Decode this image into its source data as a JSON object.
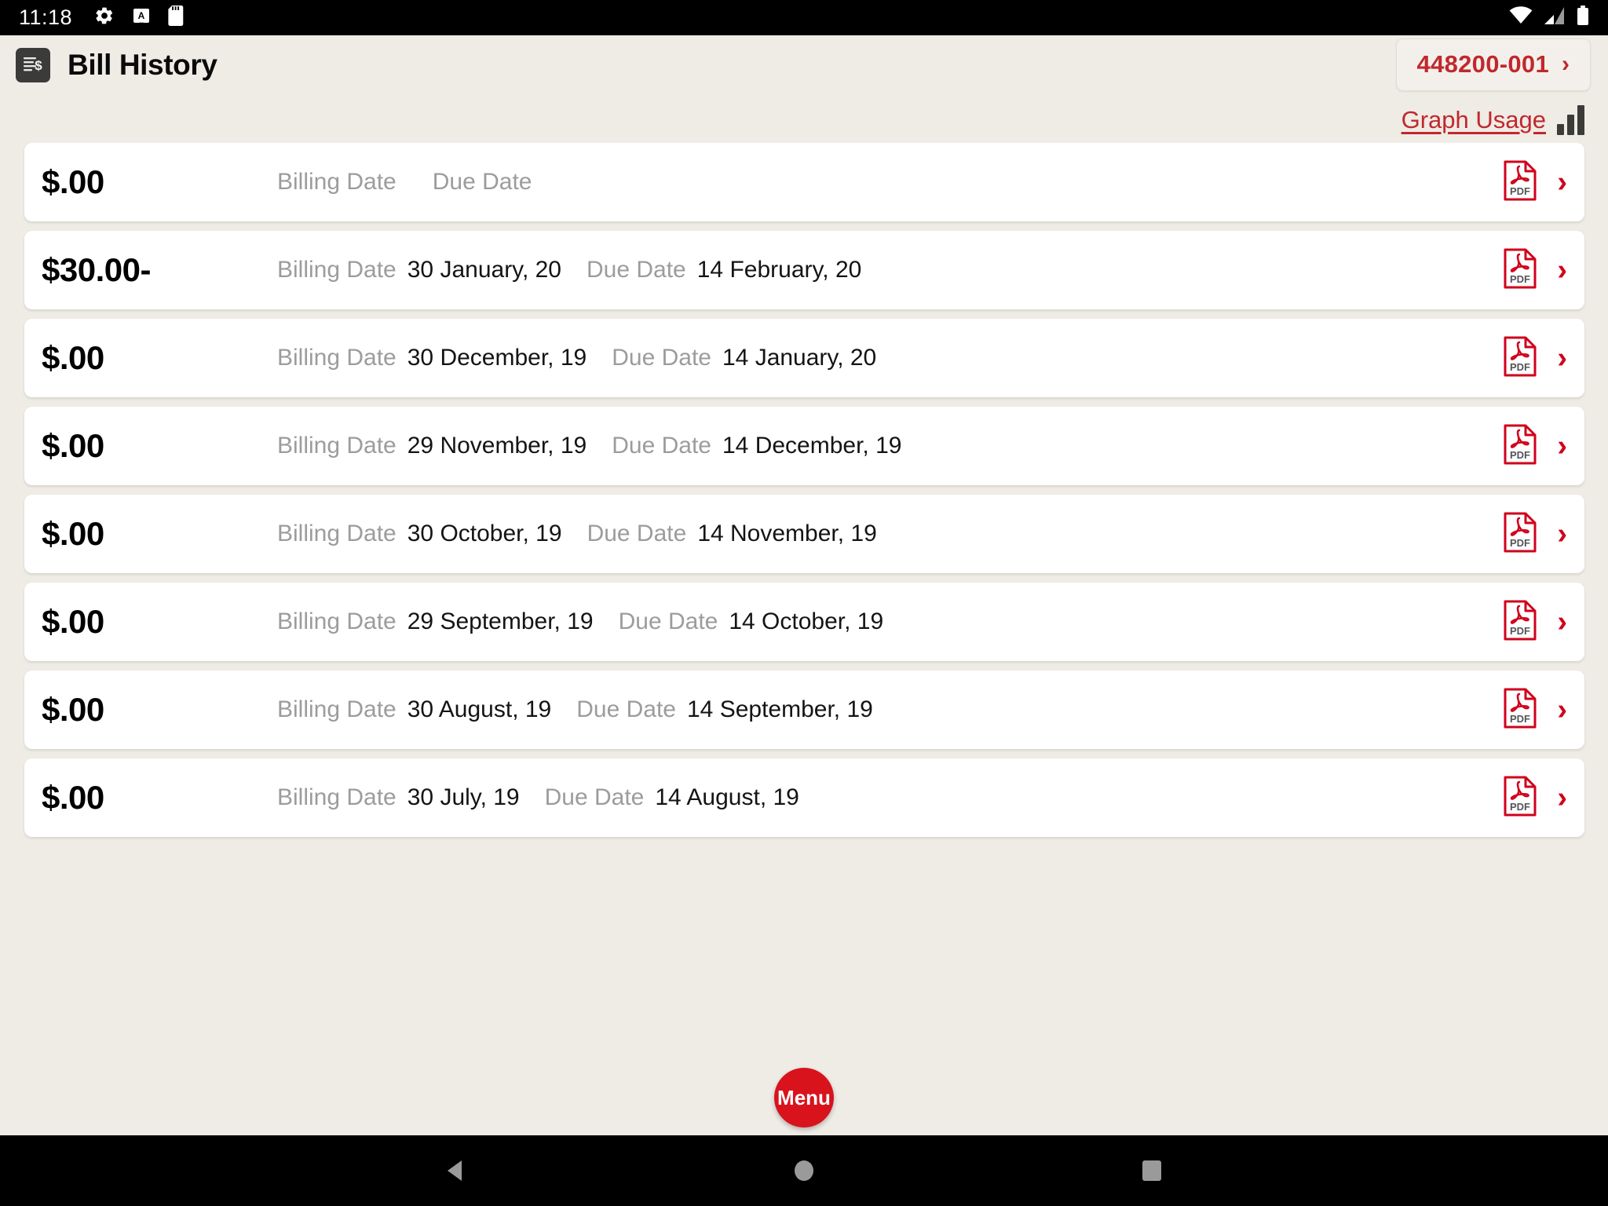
{
  "status_bar": {
    "time": "11:18",
    "left_icons": [
      "gear-icon",
      "a-letter-icon",
      "sd-card-icon"
    ],
    "right_icons": [
      "wifi-icon",
      "cellular-signal-icon",
      "battery-icon"
    ]
  },
  "header": {
    "icon": "bill-document-icon",
    "title": "Bill History",
    "account_button": {
      "number": "448200-001",
      "chevron": "›"
    }
  },
  "toolbar": {
    "graph_usage_label": "Graph Usage",
    "graph_icon": "bar-chart-icon"
  },
  "labels": {
    "billing_date": "Billing Date",
    "due_date": "Due Date",
    "pdf_label": "PDF",
    "chevron": "›"
  },
  "colors": {
    "accent_red": "#c0282d",
    "chevron_red": "#d0021b",
    "fab_red": "#d8131c",
    "page_background": "#efebe5",
    "card_background": "#ffffff",
    "muted_text": "#9c9c9c"
  },
  "bills": [
    {
      "amount": "$.00",
      "billing_date": "",
      "due_date": ""
    },
    {
      "amount": "$30.00-",
      "billing_date": "30 January, 20",
      "due_date": "14 February, 20"
    },
    {
      "amount": "$.00",
      "billing_date": "30 December, 19",
      "due_date": "14 January, 20"
    },
    {
      "amount": "$.00",
      "billing_date": "29 November, 19",
      "due_date": "14 December, 19"
    },
    {
      "amount": "$.00",
      "billing_date": "30 October, 19",
      "due_date": "14 November, 19"
    },
    {
      "amount": "$.00",
      "billing_date": "29 September, 19",
      "due_date": "14 October, 19"
    },
    {
      "amount": "$.00",
      "billing_date": "30 August, 19",
      "due_date": "14 September, 19"
    },
    {
      "amount": "$.00",
      "billing_date": "30 July, 19",
      "due_date": "14 August, 19"
    }
  ],
  "fab": {
    "label": "Menu"
  },
  "nav_bar": {
    "back": "back-triangle-icon",
    "home": "home-circle-icon",
    "recents": "recents-square-icon"
  }
}
